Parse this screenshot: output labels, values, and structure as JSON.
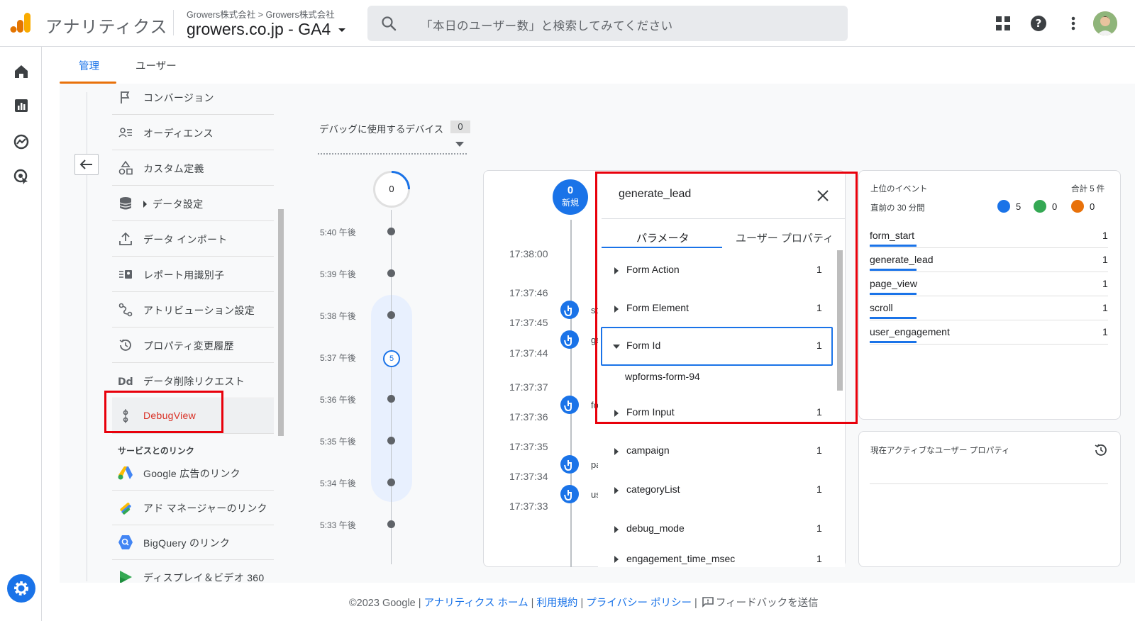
{
  "header": {
    "app_title": "アナリティクス",
    "account_crumb": "Growers株式会社 > Growers株式会社",
    "property_name": "growers.co.jp - GA4",
    "search_placeholder": "「本日のユーザー数」と検索してみてください",
    "icons": [
      "apps-grid-icon",
      "help-icon",
      "more-vert-icon"
    ]
  },
  "tabs": [
    {
      "label": "管理",
      "active": true
    },
    {
      "label": "ユーザー",
      "active": false
    }
  ],
  "nav": {
    "items": [
      {
        "label": "コンバージョン",
        "icon": "flag-icon"
      },
      {
        "label": "オーディエンス",
        "icon": "audience-icon"
      },
      {
        "label": "カスタム定義",
        "icon": "shapes-icon"
      },
      {
        "label": "データ設定",
        "icon": "database-icon"
      },
      {
        "label": "データ インポート",
        "icon": "upload-icon"
      },
      {
        "label": "レポート用識別子",
        "icon": "id-icon"
      },
      {
        "label": "アトリビューション設定",
        "icon": "attribution-icon"
      },
      {
        "label": "プロパティ変更履歴",
        "icon": "history-icon"
      },
      {
        "label": "データ削除リクエスト",
        "icon": "dd-icon"
      },
      {
        "label": "DebugView",
        "icon": "debug-icon"
      }
    ],
    "services_title": "サービスとのリンク",
    "services": [
      {
        "label": "Google 広告のリンク",
        "icon": "google-ads-icon"
      },
      {
        "label": "アド マネージャーのリンク",
        "icon": "ad-manager-icon"
      },
      {
        "label": "BigQuery のリンク",
        "icon": "bigquery-icon"
      },
      {
        "label": "ディスプレイ＆ビデオ 360",
        "icon": "dv360-icon"
      }
    ]
  },
  "devices": {
    "label": "デバッグに使用するデバイス",
    "count": "0"
  },
  "minutes": {
    "top_count": "0",
    "labels": [
      "5:40 午後",
      "5:39 午後",
      "5:38 午後",
      "5:37 午後",
      "5:36 午後",
      "5:35 午後",
      "5:34 午後",
      "5:33 午後"
    ],
    "highlight_count": "5"
  },
  "seconds": {
    "new_count": "0",
    "new_label": "新規",
    "times": [
      "17:38:00",
      "17:37:46",
      "17:37:45",
      "17:37:44",
      "17:37:37",
      "17:37:36",
      "17:37:35",
      "17:37:34",
      "17:37:33"
    ],
    "event_fragments": [
      "sc",
      "ge",
      "fo",
      "pa",
      "us"
    ]
  },
  "param_panel": {
    "title": "generate_lead",
    "tab_params": "パラメータ",
    "tab_user_props": "ユーザー プロパティ",
    "rows": [
      {
        "name": "Form Action",
        "count": "1"
      },
      {
        "name": "Form Element",
        "count": "1"
      },
      {
        "name": "Form Id",
        "count": "1"
      },
      {
        "name": "Form Input",
        "count": "1"
      },
      {
        "name": "campaign",
        "count": "1"
      },
      {
        "name": "categoryList",
        "count": "1"
      },
      {
        "name": "debug_mode",
        "count": "1"
      },
      {
        "name": "engagement_time_msec",
        "count": "1"
      }
    ],
    "form_id_value": "wpforms-form-94"
  },
  "top_events": {
    "title": "上位のイベント",
    "total": "合計 5 件",
    "period": "直前の 30 分間",
    "badges": [
      {
        "count": "5",
        "color": "#1a73e8"
      },
      {
        "count": "0",
        "color": "#34a853"
      },
      {
        "count": "0",
        "color": "#e8710a"
      }
    ],
    "rows": [
      {
        "name": "form_start",
        "value": "1"
      },
      {
        "name": "generate_lead",
        "value": "1"
      },
      {
        "name": "page_view",
        "value": "1"
      },
      {
        "name": "scroll",
        "value": "1"
      },
      {
        "name": "user_engagement",
        "value": "1"
      }
    ]
  },
  "active_props": {
    "title": "現在アクティブなユーザー プロパティ"
  },
  "footer": {
    "copyright": "©2023 Google",
    "home": "アナリティクス ホーム",
    "terms": "利用規約",
    "privacy": "プライバシー ポリシー",
    "feedback": "フィードバックを送信",
    "sep": "|"
  },
  "colors": {
    "accent": "#1a73e8",
    "highlight_red": "#e8000b",
    "tab_orange": "#e8710a"
  }
}
